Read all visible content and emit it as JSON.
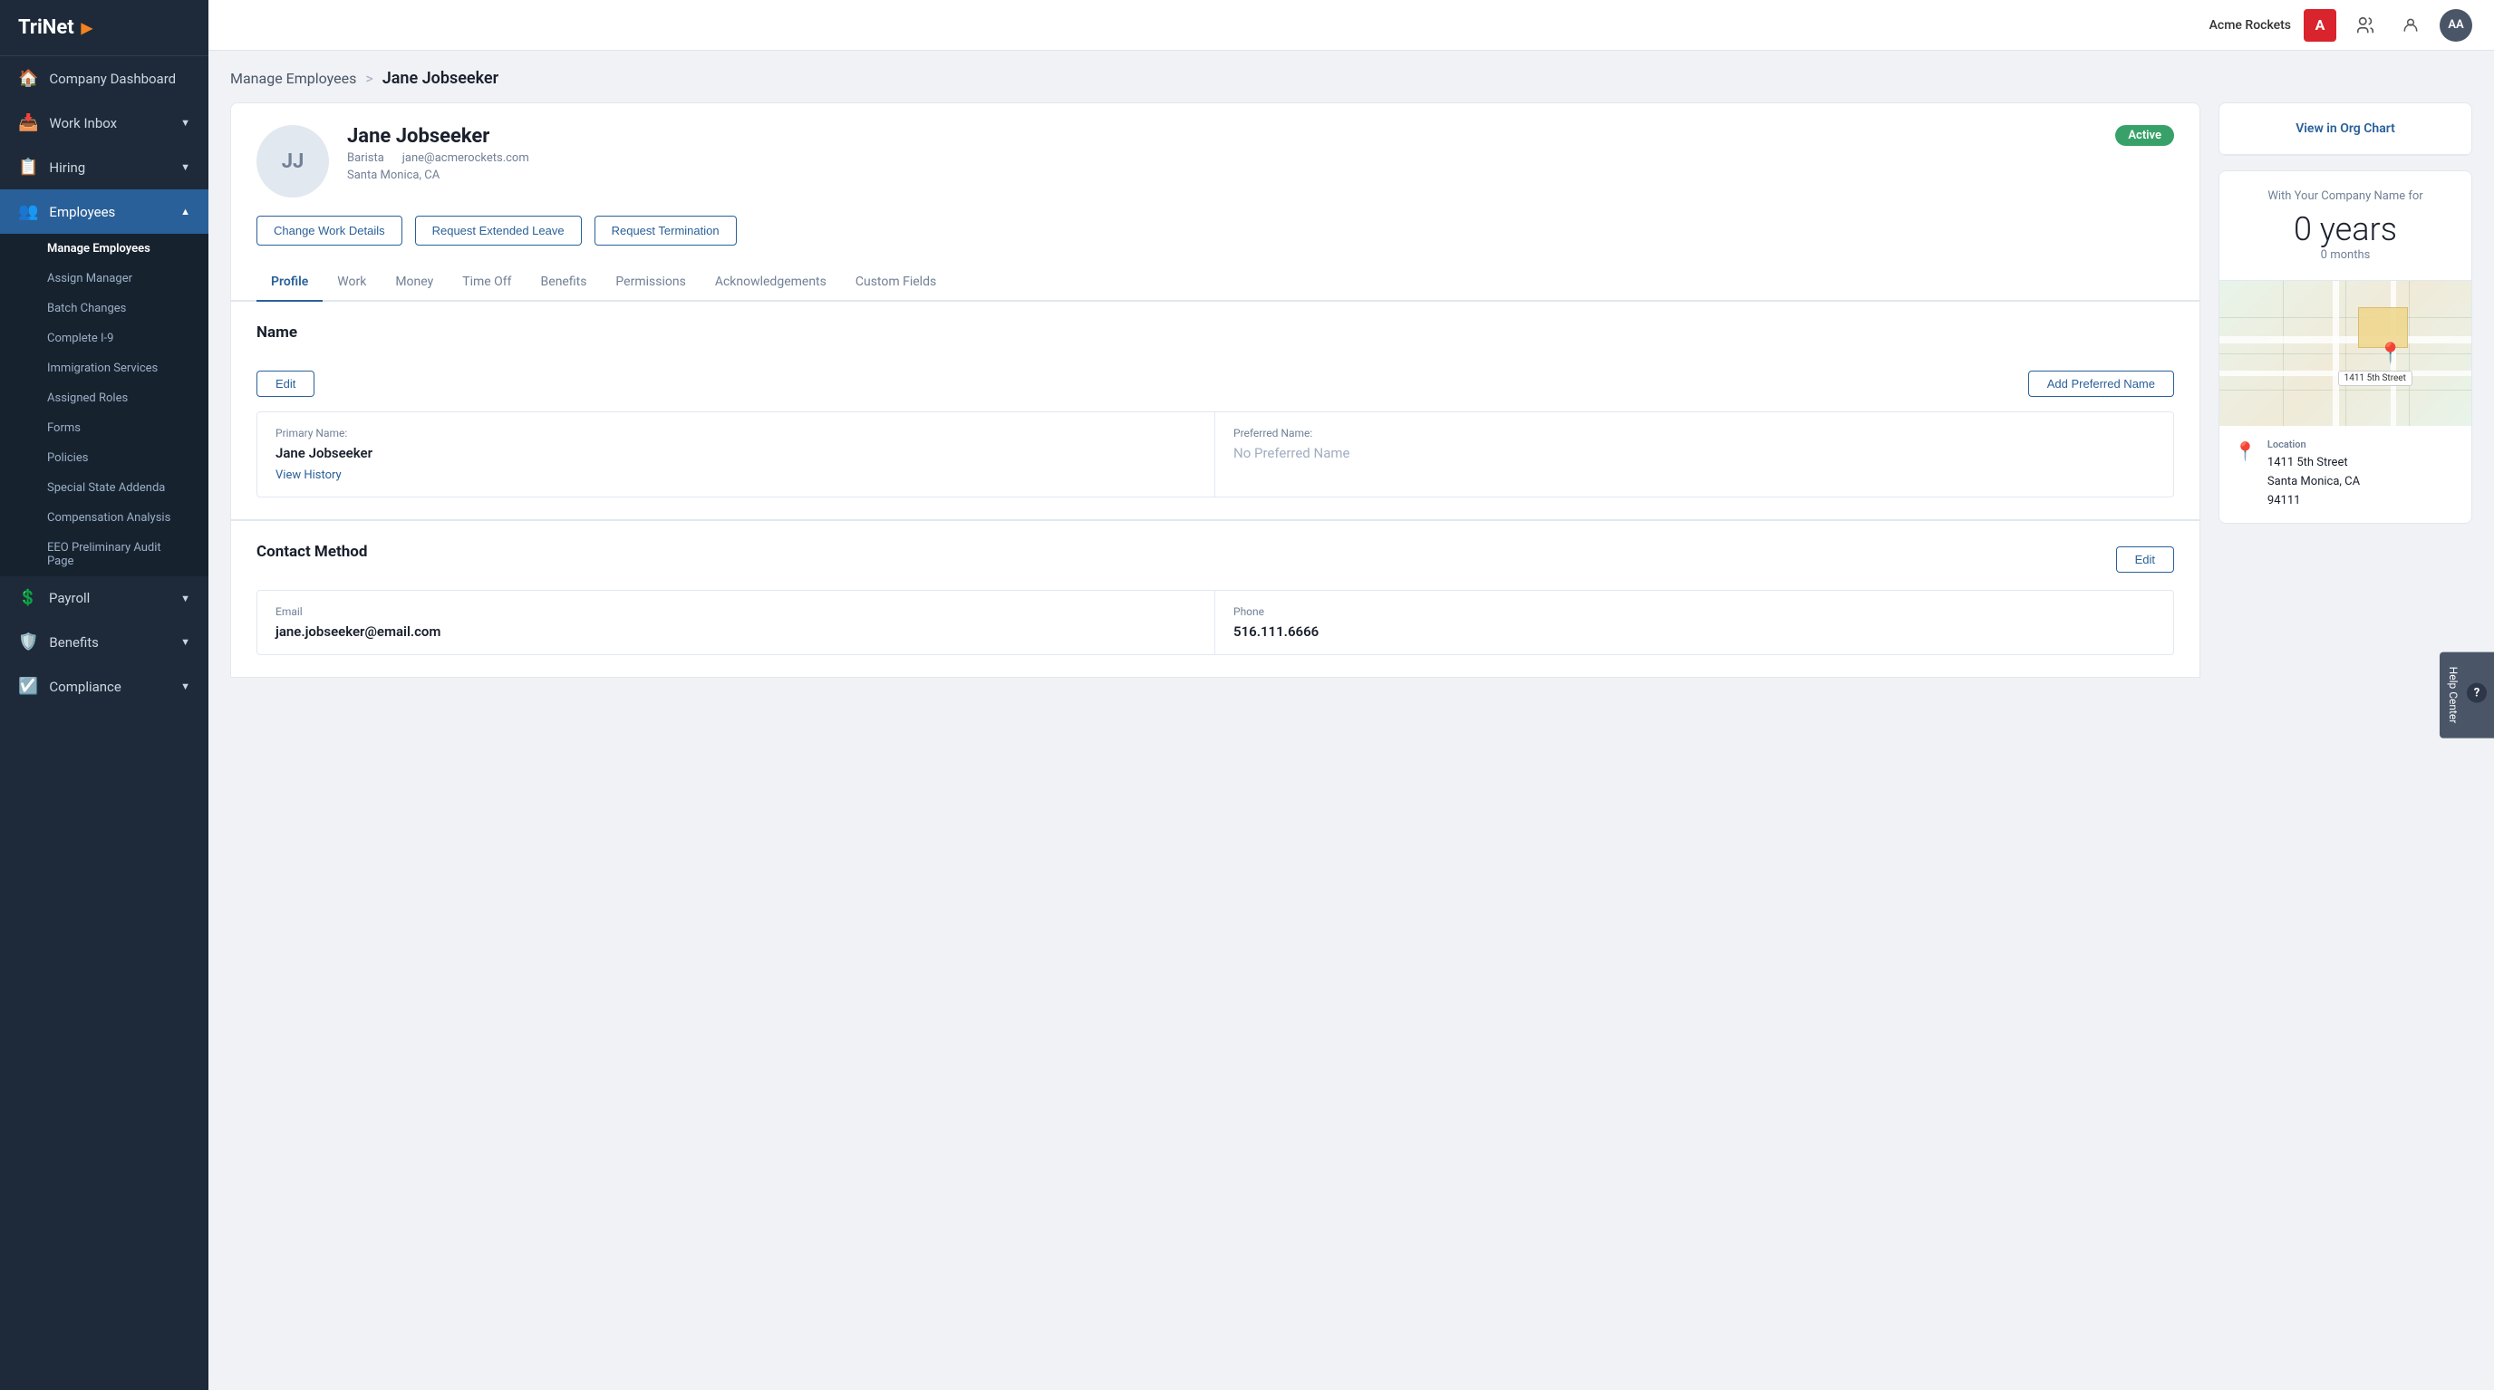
{
  "sidebar": {
    "logo": "TriNet",
    "logo_arrow": "▶",
    "nav_items": [
      {
        "id": "company-dashboard",
        "label": "Company Dashboard",
        "icon": "🏠",
        "active": false,
        "has_chevron": false
      },
      {
        "id": "work-inbox",
        "label": "Work Inbox",
        "icon": "📥",
        "active": false,
        "has_chevron": true
      },
      {
        "id": "hiring",
        "label": "Hiring",
        "icon": "📋",
        "active": false,
        "has_chevron": true
      },
      {
        "id": "employees",
        "label": "Employees",
        "icon": "👥",
        "active": true,
        "has_chevron": true
      }
    ],
    "sub_nav": [
      {
        "id": "manage-employees",
        "label": "Manage Employees",
        "active": true
      },
      {
        "id": "assign-manager",
        "label": "Assign Manager",
        "active": false
      },
      {
        "id": "batch-changes",
        "label": "Batch Changes",
        "active": false
      },
      {
        "id": "complete-i9",
        "label": "Complete I-9",
        "active": false
      },
      {
        "id": "immigration-services",
        "label": "Immigration Services",
        "active": false
      },
      {
        "id": "assigned-roles",
        "label": "Assigned Roles",
        "active": false
      },
      {
        "id": "forms",
        "label": "Forms",
        "active": false
      },
      {
        "id": "policies",
        "label": "Policies",
        "active": false
      },
      {
        "id": "special-state-addenda",
        "label": "Special State Addenda",
        "active": false
      },
      {
        "id": "compensation-analysis",
        "label": "Compensation Analysis",
        "active": false
      },
      {
        "id": "eeo-audit",
        "label": "EEO Preliminary Audit Page",
        "active": false
      }
    ],
    "bottom_nav": [
      {
        "id": "payroll",
        "label": "Payroll",
        "icon": "$",
        "has_chevron": true
      },
      {
        "id": "benefits",
        "label": "Benefits",
        "icon": "♡",
        "has_chevron": true
      },
      {
        "id": "compliance",
        "label": "Compliance",
        "icon": "✓",
        "has_chevron": true
      }
    ]
  },
  "topbar": {
    "company_name": "Acme Rockets",
    "company_initial": "A",
    "avatar_initials": "AA"
  },
  "breadcrumb": {
    "parent": "Manage Employees",
    "separator": ">",
    "current": "Jane Jobseeker"
  },
  "employee": {
    "initials": "JJ",
    "name": "Jane Jobseeker",
    "title": "Barista",
    "email": "jane@acmerockets.com",
    "location": "Santa Monica, CA",
    "status": "Active",
    "buttons": {
      "change_work": "Change Work Details",
      "extended_leave": "Request Extended Leave",
      "termination": "Request Termination"
    }
  },
  "tabs": [
    {
      "id": "profile",
      "label": "Profile",
      "active": true
    },
    {
      "id": "work",
      "label": "Work",
      "active": false
    },
    {
      "id": "money",
      "label": "Money",
      "active": false
    },
    {
      "id": "time-off",
      "label": "Time Off",
      "active": false
    },
    {
      "id": "benefits",
      "label": "Benefits",
      "active": false
    },
    {
      "id": "permissions",
      "label": "Permissions",
      "active": false
    },
    {
      "id": "acknowledgements",
      "label": "Acknowledgements",
      "active": false
    },
    {
      "id": "custom-fields",
      "label": "Custom Fields",
      "active": false
    }
  ],
  "profile": {
    "name_section": {
      "title": "Name",
      "edit_label": "Edit",
      "add_preferred_label": "Add Preferred Name",
      "primary_label": "Primary Name:",
      "primary_value": "Jane Jobseeker",
      "preferred_label": "Preferred Name:",
      "preferred_placeholder": "No Preferred Name",
      "view_history": "View History"
    },
    "contact_section": {
      "title": "Contact Method",
      "edit_label": "Edit",
      "email_label": "Email",
      "email_value": "jane.jobseeker@email.com",
      "phone_label": "Phone",
      "phone_value": "516.111.6666"
    }
  },
  "side_panel": {
    "org_chart_link": "View in Org Chart",
    "tenure": {
      "with_company_label": "With Your Company Name for",
      "years_value": "0 years",
      "months_value": "0 months"
    },
    "location": {
      "label": "Location",
      "address_line1": "1411 5th Street",
      "address_line2": "Santa Monica, CA",
      "address_line3": "94111"
    },
    "map_label": "1411 5th Street"
  },
  "help_center": {
    "q_mark": "?",
    "label": "Help Center"
  }
}
